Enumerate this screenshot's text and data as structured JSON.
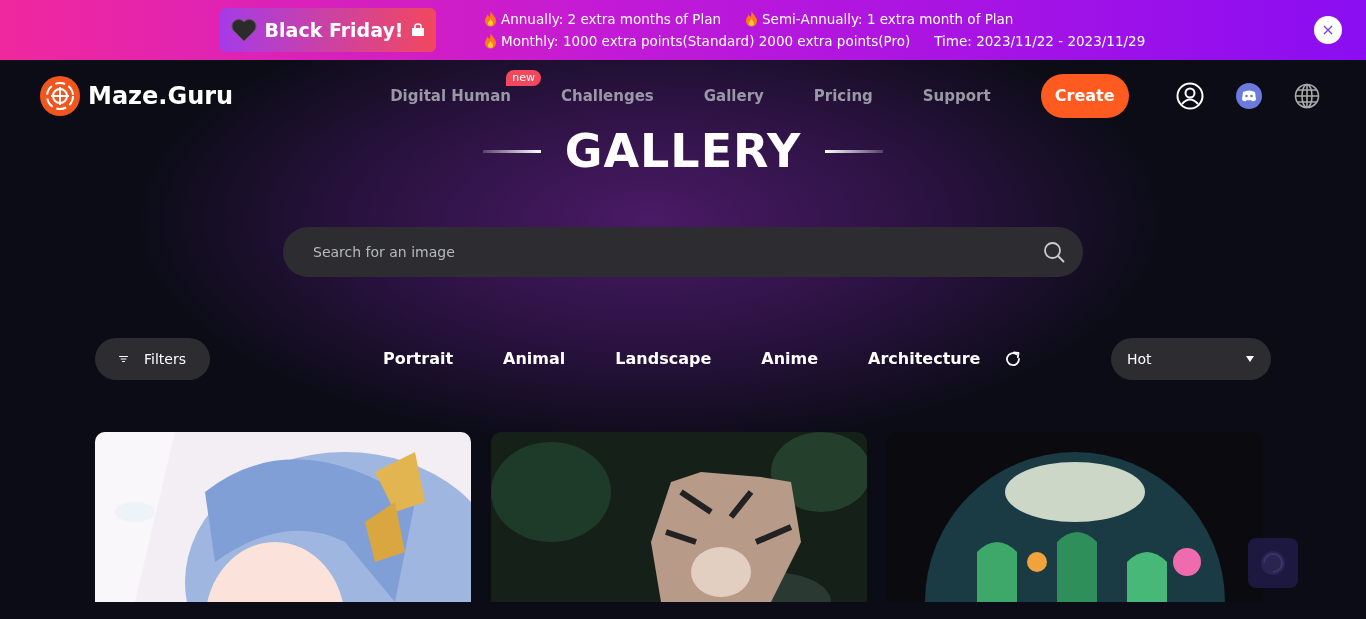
{
  "banner": {
    "title": "Black Friday!",
    "rows": [
      [
        {
          "kind": "promo",
          "text": "Annually: 2 extra months of Plan"
        },
        {
          "kind": "promo",
          "text": "Semi-Annually: 1 extra month of Plan"
        }
      ],
      [
        {
          "kind": "promo",
          "text": "Monthly: 1000 extra points(Standard) 2000 extra points(Pro)"
        },
        {
          "kind": "time",
          "text": "Time: 2023/11/22 - 2023/11/29"
        }
      ]
    ]
  },
  "navbar": {
    "logo": "Maze.Guru",
    "links": [
      {
        "label": "Digital Human",
        "badge": "new"
      },
      {
        "label": "Challenges"
      },
      {
        "label": "Gallery"
      },
      {
        "label": "Pricing"
      },
      {
        "label": "Support"
      }
    ],
    "create_button": "Create"
  },
  "hero": {
    "title": "GALLERY",
    "search": {
      "placeholder": "Search for an image"
    }
  },
  "toolbar": {
    "filters_button": "Filters",
    "categories": [
      "Portrait",
      "Animal",
      "Landscape",
      "Anime",
      "Architecture"
    ],
    "sort": "Hot"
  },
  "gallery": [
    {
      "kind": "anime"
    },
    {
      "kind": "tiger"
    },
    {
      "kind": "terrarium"
    }
  ]
}
